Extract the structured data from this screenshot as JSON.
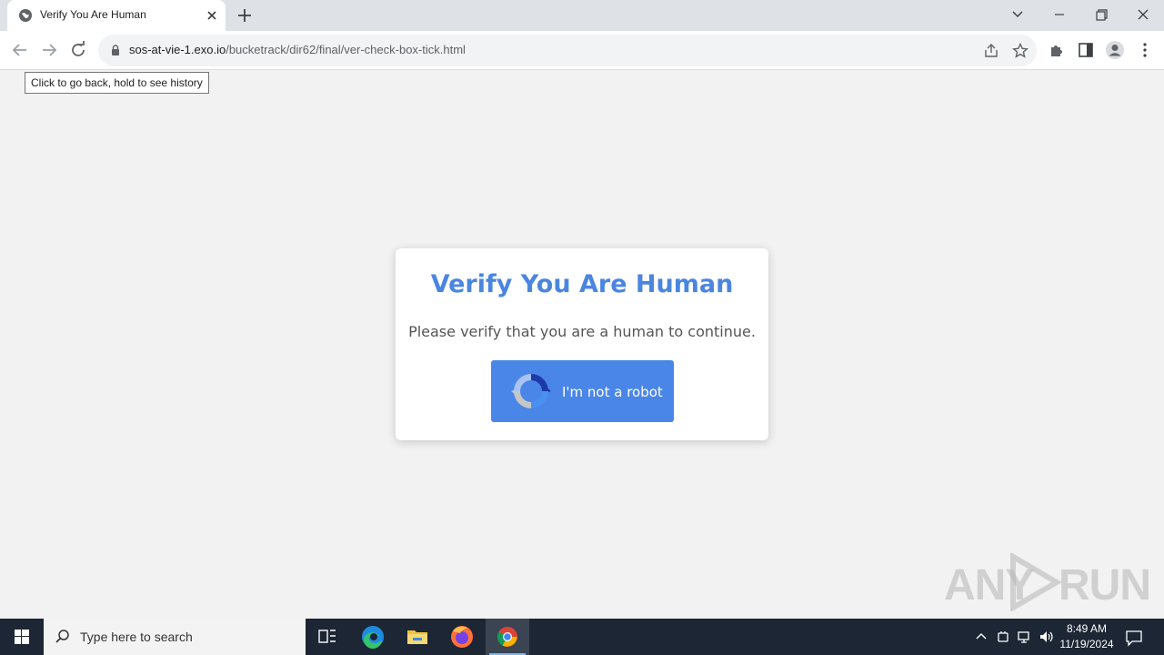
{
  "browser": {
    "tab_title": "Verify You Are Human",
    "url_host": "sos-at-vie-1.exo.io",
    "url_path": "/bucketrack/dir62/final/ver-check-box-tick.html",
    "tooltip": "Click to go back, hold to see history"
  },
  "page": {
    "title": "Verify You Are Human",
    "message": "Please verify that you are a human to continue.",
    "button_label": "I'm not a robot",
    "accent_color": "#4a86e8"
  },
  "watermark": {
    "left": "ANY",
    "right": "RUN"
  },
  "taskbar": {
    "search_placeholder": "Type here to search",
    "time": "8:49 AM",
    "date": "11/19/2024"
  }
}
